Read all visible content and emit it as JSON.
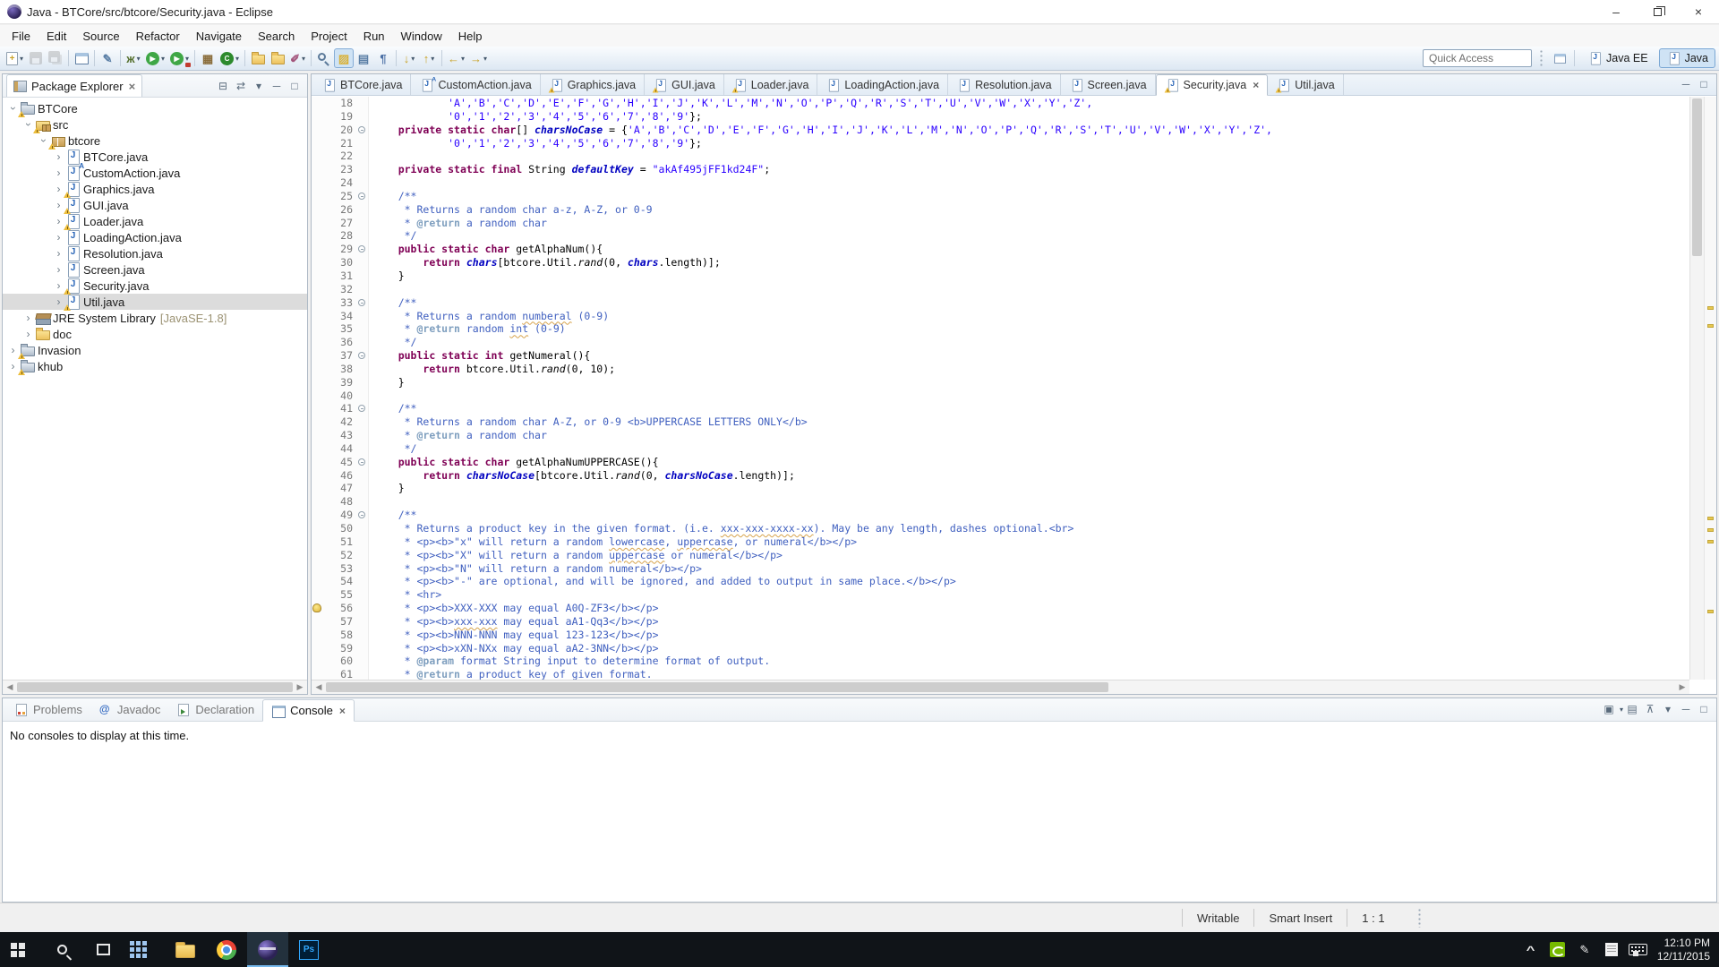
{
  "window": {
    "title": "Java - BTCore/src/btcore/Security.java - Eclipse"
  },
  "menu": [
    "File",
    "Edit",
    "Source",
    "Refactor",
    "Navigate",
    "Search",
    "Project",
    "Run",
    "Window",
    "Help"
  ],
  "toolbar": {
    "quick_access_placeholder": "Quick Access",
    "items": [
      {
        "name": "new-wizard",
        "shape": "sheet",
        "glyph": "+",
        "fg": "#c9a227",
        "dropdown": true
      },
      {
        "name": "save",
        "shape": "floppy",
        "disabled": true
      },
      {
        "name": "save-all",
        "shape": "floppy2",
        "disabled": true
      },
      {
        "sep": true
      },
      {
        "name": "print",
        "shape": "window"
      },
      {
        "sep": true
      },
      {
        "name": "skip-all-breakpoints",
        "shape": "plain",
        "glyph": "✎",
        "fg": "#5b7fa6"
      },
      {
        "sep": true
      },
      {
        "name": "debug",
        "shape": "plain",
        "glyph": "ж",
        "fg": "#55702e",
        "dropdown": true
      },
      {
        "name": "run",
        "shape": "circle",
        "glyph": "▶",
        "fg": "#ffffff",
        "bg": "#3fa746",
        "dropdown": true
      },
      {
        "name": "run-external-tools",
        "shape": "circle",
        "glyph": "▶",
        "fg": "#ffffff",
        "bg": "#3fa746",
        "overlay": "red",
        "dropdown": true
      },
      {
        "sep": true
      },
      {
        "name": "new-java-project",
        "shape": "plain",
        "glyph": "▦",
        "fg": "#8a6d3b"
      },
      {
        "name": "new-java-class",
        "shape": "circle",
        "glyph": "C",
        "fg": "#ffffff",
        "bg": "#2d8a2d",
        "dropdown": true
      },
      {
        "sep": true
      },
      {
        "name": "team-folder",
        "shape": "folder"
      },
      {
        "name": "open-folder",
        "shape": "folder"
      },
      {
        "name": "paintbrush",
        "shape": "plain",
        "glyph": "✐",
        "fg": "#a2527a",
        "dropdown": true
      },
      {
        "sep": true
      },
      {
        "name": "search",
        "shape": "magnifier"
      },
      {
        "name": "mark-occurrences",
        "shape": "plain",
        "glyph": "▨",
        "fg": "#d9b23a",
        "active": true
      },
      {
        "name": "show-selected-element",
        "shape": "plain",
        "glyph": "▤",
        "fg": "#5b7fa6"
      },
      {
        "name": "show-whitespace",
        "shape": "plain",
        "glyph": "¶",
        "fg": "#4a6fa5"
      },
      {
        "sep": true
      },
      {
        "name": "next-annotation",
        "shape": "plain",
        "glyph": "↓",
        "fg": "#c9a227",
        "dropdown": true
      },
      {
        "name": "previous-annotation",
        "shape": "plain",
        "glyph": "↑",
        "fg": "#c9a227",
        "dropdown": true
      },
      {
        "sep": true
      },
      {
        "name": "back-history",
        "shape": "plain",
        "glyph": "←",
        "fg": "#c9a227",
        "dropdown": true
      },
      {
        "name": "forward-history",
        "shape": "plain",
        "glyph": "→",
        "fg": "#c9a227",
        "dropdown": true
      }
    ],
    "perspectives": [
      {
        "label": "Java EE",
        "active": false
      },
      {
        "label": "Java",
        "active": true
      }
    ]
  },
  "package_explorer": {
    "title": "Package Explorer",
    "header_icons": [
      {
        "name": "collapse-all",
        "glyph": "⊟"
      },
      {
        "name": "link-with-editor",
        "glyph": "⇄"
      },
      {
        "name": "view-menu",
        "glyph": "▾"
      },
      {
        "name": "minimize-view",
        "glyph": "─"
      },
      {
        "name": "maximize-view",
        "glyph": "□"
      }
    ],
    "tree": [
      {
        "label": "BTCore",
        "icon": "project",
        "depth": 0,
        "expanded": true,
        "warn": true
      },
      {
        "label": "src",
        "icon": "src",
        "depth": 1,
        "expanded": true,
        "warn": true
      },
      {
        "label": "btcore",
        "icon": "package",
        "depth": 2,
        "expanded": true,
        "warn": true
      },
      {
        "label": "BTCore.java",
        "icon": "jfile",
        "depth": 3
      },
      {
        "label": "CustomAction.java",
        "icon": "jfile",
        "depth": 3,
        "badge": "A"
      },
      {
        "label": "Graphics.java",
        "icon": "jfile",
        "depth": 3,
        "warn": true
      },
      {
        "label": "GUI.java",
        "icon": "jfile",
        "depth": 3,
        "warn": true
      },
      {
        "label": "Loader.java",
        "icon": "jfile",
        "depth": 3,
        "warn": true
      },
      {
        "label": "LoadingAction.java",
        "icon": "jfile",
        "depth": 3
      },
      {
        "label": "Resolution.java",
        "icon": "jfile",
        "depth": 3
      },
      {
        "label": "Screen.java",
        "icon": "jfile",
        "depth": 3
      },
      {
        "label": "Security.java",
        "icon": "jfile",
        "depth": 3,
        "warn": true
      },
      {
        "label": "Util.java",
        "icon": "jfile",
        "depth": 3,
        "warn": true,
        "selected": true
      },
      {
        "label": "JRE System Library",
        "suffix": "[JavaSE-1.8]",
        "icon": "library",
        "depth": 1
      },
      {
        "label": "doc",
        "icon": "folder",
        "depth": 1
      },
      {
        "label": "Invasion",
        "icon": "project",
        "depth": 0,
        "warn": true
      },
      {
        "label": "khub",
        "icon": "project",
        "depth": 0,
        "warn": true
      }
    ]
  },
  "editor": {
    "tabs": [
      {
        "label": "BTCore.java"
      },
      {
        "label": "CustomAction.java",
        "badge": "A"
      },
      {
        "label": "Graphics.java",
        "warn": true
      },
      {
        "label": "GUI.java",
        "warn": true
      },
      {
        "label": "Loader.java",
        "warn": true
      },
      {
        "label": "LoadingAction.java"
      },
      {
        "label": "Resolution.java"
      },
      {
        "label": "Screen.java"
      },
      {
        "label": "Security.java",
        "warn": true,
        "active": true,
        "closable": true
      },
      {
        "label": "Util.java",
        "warn": true
      }
    ],
    "lines": [
      {
        "n": 18,
        "s": [
          [
            "pl",
            "            "
          ],
          [
            "st",
            "'A','B','C','D','E','F','G','H','I','J','K','L','M','N','O','P','Q','R','S','T','U','V','W','X','Y','Z',"
          ]
        ]
      },
      {
        "n": 19,
        "s": [
          [
            "pl",
            "            "
          ],
          [
            "st",
            "'0','1','2','3','4','5','6','7','8','9'"
          ],
          [
            "pl",
            "};"
          ]
        ]
      },
      {
        "n": 20,
        "f": 1,
        "s": [
          [
            "pl",
            "    "
          ],
          [
            "kw",
            "private static char"
          ],
          [
            "pl",
            "[] "
          ],
          [
            "fd",
            "charsNoCase"
          ],
          [
            "pl",
            " = {"
          ],
          [
            "st",
            "'A','B','C','D','E','F','G','H','I','J','K','L','M','N','O','P','Q','R','S','T','U','V','W','X','Y','Z',"
          ]
        ]
      },
      {
        "n": 21,
        "s": [
          [
            "pl",
            "            "
          ],
          [
            "st",
            "'0','1','2','3','4','5','6','7','8','9'"
          ],
          [
            "pl",
            "};"
          ]
        ]
      },
      {
        "n": 22,
        "s": []
      },
      {
        "n": 23,
        "s": [
          [
            "pl",
            "    "
          ],
          [
            "kw",
            "private static final"
          ],
          [
            "pl",
            " String "
          ],
          [
            "fd",
            "defaultKey"
          ],
          [
            "pl",
            " = "
          ],
          [
            "st",
            "\"akAf495jFF1kd24F\""
          ],
          [
            "pl",
            ";"
          ]
        ]
      },
      {
        "n": 24,
        "s": []
      },
      {
        "n": 25,
        "f": 1,
        "s": [
          [
            "pl",
            "    "
          ],
          [
            "dc",
            "/**"
          ]
        ]
      },
      {
        "n": 26,
        "s": [
          [
            "pl",
            "    "
          ],
          [
            "dc",
            " * Returns a random char a-z, A-Z, or 0-9"
          ]
        ]
      },
      {
        "n": 27,
        "s": [
          [
            "pl",
            "    "
          ],
          [
            "dc",
            " * "
          ],
          [
            "dt",
            "@return"
          ],
          [
            "dc",
            " a random char"
          ]
        ]
      },
      {
        "n": 28,
        "s": [
          [
            "pl",
            "    "
          ],
          [
            "dc",
            " */"
          ]
        ]
      },
      {
        "n": 29,
        "f": 1,
        "s": [
          [
            "pl",
            "    "
          ],
          [
            "kw",
            "public static char"
          ],
          [
            "pl",
            " getAlphaNum(){"
          ]
        ]
      },
      {
        "n": 30,
        "s": [
          [
            "pl",
            "        "
          ],
          [
            "kw",
            "return"
          ],
          [
            "pl",
            " "
          ],
          [
            "fd",
            "chars"
          ],
          [
            "pl",
            "[btcore.Util."
          ],
          [
            "mt",
            "rand"
          ],
          [
            "pl",
            "(0, "
          ],
          [
            "fd",
            "chars"
          ],
          [
            "pl",
            ".length)];"
          ]
        ]
      },
      {
        "n": 31,
        "s": [
          [
            "pl",
            "    }"
          ]
        ]
      },
      {
        "n": 32,
        "s": []
      },
      {
        "n": 33,
        "f": 1,
        "s": [
          [
            "pl",
            "    "
          ],
          [
            "dc",
            "/**"
          ]
        ]
      },
      {
        "n": 34,
        "s": [
          [
            "pl",
            "    "
          ],
          [
            "dc",
            " * Returns a random "
          ],
          [
            "dcsp",
            "numberal"
          ],
          [
            "dc",
            " (0-9)"
          ]
        ]
      },
      {
        "n": 35,
        "s": [
          [
            "pl",
            "    "
          ],
          [
            "dc",
            " * "
          ],
          [
            "dt",
            "@return"
          ],
          [
            "dc",
            " random "
          ],
          [
            "dcsp",
            "int"
          ],
          [
            "dc",
            " (0-9)"
          ]
        ]
      },
      {
        "n": 36,
        "s": [
          [
            "pl",
            "    "
          ],
          [
            "dc",
            " */"
          ]
        ]
      },
      {
        "n": 37,
        "f": 1,
        "s": [
          [
            "pl",
            "    "
          ],
          [
            "kw",
            "public static int"
          ],
          [
            "pl",
            " getNumeral(){"
          ]
        ]
      },
      {
        "n": 38,
        "s": [
          [
            "pl",
            "        "
          ],
          [
            "kw",
            "return"
          ],
          [
            "pl",
            " btcore.Util."
          ],
          [
            "mt",
            "rand"
          ],
          [
            "pl",
            "(0, 10);"
          ]
        ]
      },
      {
        "n": 39,
        "s": [
          [
            "pl",
            "    }"
          ]
        ]
      },
      {
        "n": 40,
        "s": []
      },
      {
        "n": 41,
        "f": 1,
        "s": [
          [
            "pl",
            "    "
          ],
          [
            "dc",
            "/**"
          ]
        ]
      },
      {
        "n": 42,
        "s": [
          [
            "pl",
            "    "
          ],
          [
            "dc",
            " * Returns a random char A-Z, or 0-9 <b>UPPERCASE LETTERS ONLY</b>"
          ]
        ]
      },
      {
        "n": 43,
        "s": [
          [
            "pl",
            "    "
          ],
          [
            "dc",
            " * "
          ],
          [
            "dt",
            "@return"
          ],
          [
            "dc",
            " a random char"
          ]
        ]
      },
      {
        "n": 44,
        "s": [
          [
            "pl",
            "    "
          ],
          [
            "dc",
            " */"
          ]
        ]
      },
      {
        "n": 45,
        "f": 1,
        "s": [
          [
            "pl",
            "    "
          ],
          [
            "kw",
            "public static char"
          ],
          [
            "pl",
            " getAlphaNumUPPERCASE(){"
          ]
        ]
      },
      {
        "n": 46,
        "s": [
          [
            "pl",
            "        "
          ],
          [
            "kw",
            "return"
          ],
          [
            "pl",
            " "
          ],
          [
            "fd",
            "charsNoCase"
          ],
          [
            "pl",
            "[btcore.Util."
          ],
          [
            "mt",
            "rand"
          ],
          [
            "pl",
            "(0, "
          ],
          [
            "fd",
            "charsNoCase"
          ],
          [
            "pl",
            ".length)];"
          ]
        ]
      },
      {
        "n": 47,
        "s": [
          [
            "pl",
            "    }"
          ]
        ]
      },
      {
        "n": 48,
        "s": []
      },
      {
        "n": 49,
        "f": 1,
        "s": [
          [
            "pl",
            "    "
          ],
          [
            "dc",
            "/**"
          ]
        ]
      },
      {
        "n": 50,
        "s": [
          [
            "pl",
            "    "
          ],
          [
            "dc",
            " * Returns a product key in the given format. (i.e. "
          ],
          [
            "dcsp",
            "xxx-xxx-xxxx-xx"
          ],
          [
            "dc",
            "). May be any length, dashes optional.<br>"
          ]
        ]
      },
      {
        "n": 51,
        "s": [
          [
            "pl",
            "    "
          ],
          [
            "dc",
            " * <p><b>\"x\" will return a random "
          ],
          [
            "dcsp",
            "lowercase"
          ],
          [
            "dc",
            ", "
          ],
          [
            "dcsp",
            "uppercase"
          ],
          [
            "dc",
            ", or numeral</b></p>"
          ]
        ]
      },
      {
        "n": 52,
        "s": [
          [
            "pl",
            "    "
          ],
          [
            "dc",
            " * <p><b>\"X\" will return a random "
          ],
          [
            "dcsp",
            "uppercase"
          ],
          [
            "dc",
            " or numeral</b></p>"
          ]
        ]
      },
      {
        "n": 53,
        "s": [
          [
            "pl",
            "    "
          ],
          [
            "dc",
            " * <p><b>\"N\" will return a random numeral</b></p>"
          ]
        ]
      },
      {
        "n": 54,
        "s": [
          [
            "pl",
            "    "
          ],
          [
            "dc",
            " * <p><b>\"-\" are optional, and will be ignored, and added to output in same place.</b></p>"
          ]
        ]
      },
      {
        "n": 55,
        "s": [
          [
            "pl",
            "    "
          ],
          [
            "dc",
            " * <hr>"
          ]
        ]
      },
      {
        "n": 56,
        "m": 1,
        "s": [
          [
            "pl",
            "    "
          ],
          [
            "dc",
            " * <p><b>XXX-XXX may equal A0Q-ZF3</b></p>"
          ]
        ]
      },
      {
        "n": 57,
        "s": [
          [
            "pl",
            "    "
          ],
          [
            "dc",
            " * <p><b>"
          ],
          [
            "dcsp",
            "xxx-xxx"
          ],
          [
            "dc",
            " may equal aA1-Qq3</b></p>"
          ]
        ]
      },
      {
        "n": 58,
        "s": [
          [
            "pl",
            "    "
          ],
          [
            "dc",
            " * <p><b>NNN-NNN may equal 123-123</b></p>"
          ]
        ]
      },
      {
        "n": 59,
        "s": [
          [
            "pl",
            "    "
          ],
          [
            "dc",
            " * <p><b>xXN-NXx may equal aA2-3NN</b></p>"
          ]
        ]
      },
      {
        "n": 60,
        "s": [
          [
            "pl",
            "    "
          ],
          [
            "dc",
            " * "
          ],
          [
            "dt",
            "@param"
          ],
          [
            "dc",
            " format String input to determine format of output."
          ]
        ]
      },
      {
        "n": 61,
        "s": [
          [
            "pl",
            "    "
          ],
          [
            "dc",
            " * "
          ],
          [
            "dt",
            "@return"
          ],
          [
            "dc",
            " a product key of given format."
          ]
        ]
      }
    ],
    "ruler_marks_pct": [
      36,
      39,
      72,
      74,
      76,
      88
    ]
  },
  "console": {
    "tabs": [
      {
        "label": "Problems",
        "icon": "problems"
      },
      {
        "label": "Javadoc",
        "icon": "javadoc"
      },
      {
        "label": "Declaration",
        "icon": "declaration"
      },
      {
        "label": "Console",
        "icon": "console",
        "active": true,
        "closable": true
      }
    ],
    "toolbar_icons": [
      {
        "name": "open-console",
        "glyph": "▣",
        "dropdown": true
      },
      {
        "name": "display-selected-console",
        "glyph": "▤"
      },
      {
        "name": "pin-console",
        "glyph": "⊼"
      },
      {
        "name": "view-menu",
        "glyph": "▾"
      },
      {
        "name": "minimize-view",
        "glyph": "─"
      },
      {
        "name": "maximize-view",
        "glyph": "□"
      }
    ],
    "message": "No consoles to display at this time."
  },
  "status_bar": {
    "writable": "Writable",
    "insert_mode": "Smart Insert",
    "caret_position": "1 : 1"
  },
  "taskbar": {
    "time": "12:10 PM",
    "date": "12/11/2015"
  }
}
